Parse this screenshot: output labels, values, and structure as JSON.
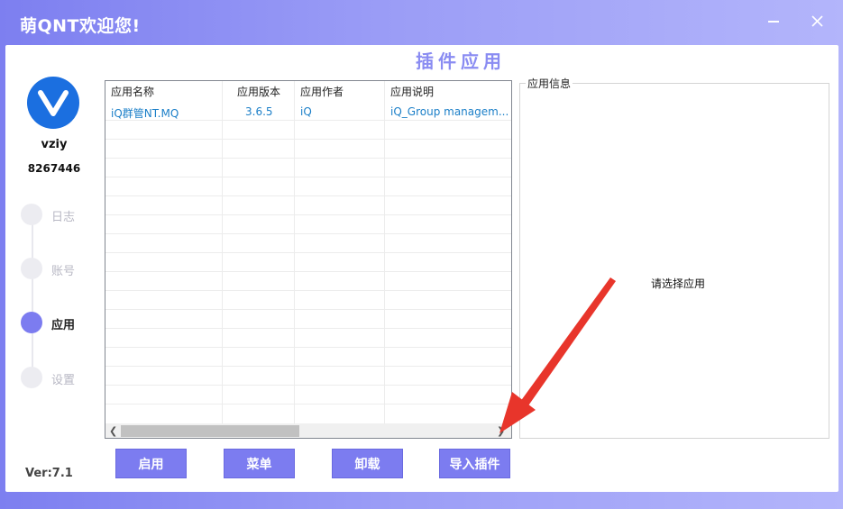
{
  "window": {
    "title": "萌QNT欢迎您!"
  },
  "sidebar": {
    "user_name": "vziy",
    "user_id": "8267446",
    "nav": [
      {
        "label": "日志",
        "active": false
      },
      {
        "label": "账号",
        "active": false
      },
      {
        "label": "应用",
        "active": true
      },
      {
        "label": "设置",
        "active": false
      }
    ],
    "version": "Ver:7.1"
  },
  "main": {
    "title": "插件应用",
    "table": {
      "columns": [
        "应用名称",
        "应用版本",
        "应用作者",
        "应用说明"
      ],
      "rows": [
        [
          "iQ群管NT.MQ",
          "3.6.5",
          "iQ",
          "iQ_Group managem..."
        ]
      ]
    },
    "info_panel": {
      "legend": "应用信息",
      "placeholder": "请选择应用"
    },
    "buttons": {
      "enable": "启用",
      "menu": "菜单",
      "uninstall": "卸载",
      "import": "导入插件"
    }
  },
  "colors": {
    "accent": "#7c7cf0",
    "title_purple": "#8a8cf2",
    "link_blue": "#1b7fc8",
    "avatar_blue": "#1b6fe0",
    "annotation_red": "#e8352b"
  }
}
